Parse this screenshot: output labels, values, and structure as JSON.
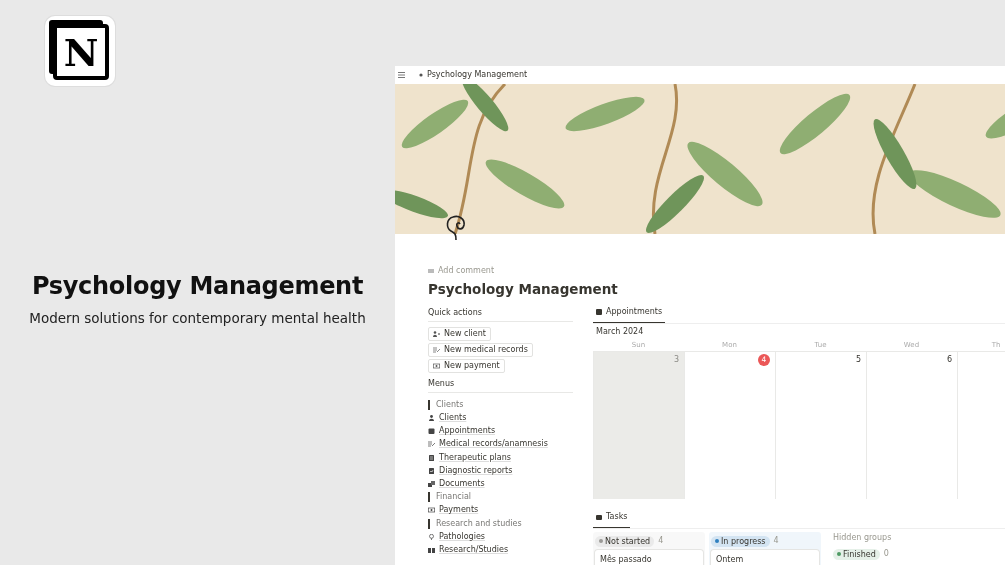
{
  "brand": {
    "logo_letter": "N",
    "title": "Psychology Management",
    "subtitle": "Modern solutions for contemporary mental health"
  },
  "window": {
    "breadcrumb": "Psychology Management",
    "add_comment": "Add comment",
    "title": "Psychology Management"
  },
  "quick_actions": {
    "heading": "Quick actions",
    "buttons": [
      "New client",
      "New medical records",
      "New payment"
    ]
  },
  "menus": {
    "heading": "Menus",
    "items": [
      {
        "kind": "section",
        "label": "Clients"
      },
      {
        "kind": "link",
        "label": "Clients"
      },
      {
        "kind": "link",
        "label": "Appointments"
      },
      {
        "kind": "link",
        "label": "Medical records/anamnesis"
      },
      {
        "kind": "link",
        "label": "Therapeutic plans"
      },
      {
        "kind": "link",
        "label": "Diagnostic reports"
      },
      {
        "kind": "link",
        "label": "Documents"
      },
      {
        "kind": "section",
        "label": "Financial"
      },
      {
        "kind": "link",
        "label": "Payments"
      },
      {
        "kind": "section",
        "label": "Research and studies"
      },
      {
        "kind": "link",
        "label": "Pathologies"
      },
      {
        "kind": "link",
        "label": "Research/Studies"
      }
    ]
  },
  "calendar": {
    "tab": "Appointments",
    "month": "March 2024",
    "weekdays": [
      "Sun",
      "Mon",
      "Tue",
      "Wed",
      "Th"
    ],
    "days": [
      {
        "label": "3",
        "today": false,
        "weekend": true
      },
      {
        "label": "4",
        "today": true,
        "weekend": false
      },
      {
        "label": "5",
        "today": false,
        "weekend": false
      },
      {
        "label": "6",
        "today": false,
        "weekend": false
      },
      {
        "weekend": false
      }
    ]
  },
  "tasks": {
    "tab": "Tasks",
    "groups": [
      {
        "status": "Not started",
        "color": "#9b9a97",
        "count": "4",
        "card": "Mês passado"
      },
      {
        "status": "In progress",
        "color": "#2f80c0",
        "count": "4",
        "card": "Ontem"
      }
    ],
    "hidden_heading": "Hidden groups",
    "hidden": [
      {
        "status": "Finished",
        "color": "#4f9a64",
        "count": "0"
      }
    ]
  }
}
